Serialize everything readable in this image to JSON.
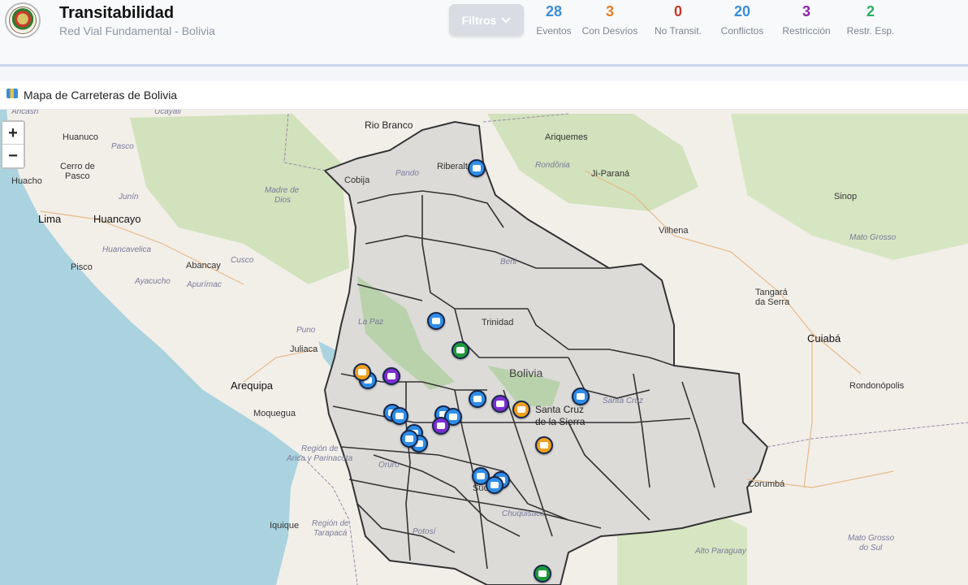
{
  "header": {
    "title": "Transitabilidad",
    "subtitle": "Red Vial Fundamental - Bolivia",
    "filter_label": "Filtros"
  },
  "stats": [
    {
      "value": "28",
      "label": "Eventos",
      "color": "#3b8ed6"
    },
    {
      "value": "3",
      "label": "Con Desvíos",
      "color": "#e67e22"
    },
    {
      "value": "0",
      "label": "No Transit.",
      "color": "#c0392b"
    },
    {
      "value": "20",
      "label": "Conflictos",
      "color": "#3b8ed6"
    },
    {
      "value": "3",
      "label": "Restricción",
      "color": "#8e24aa"
    },
    {
      "value": "2",
      "label": "Restr. Esp.",
      "color": "#27ae60"
    }
  ],
  "section": {
    "title": "Mapa de Carreteras de Bolivia"
  },
  "map": {
    "zoom_in": "+",
    "zoom_out": "−",
    "labels": {
      "rio_branco": "Rio Branco",
      "ariquemes": "Ariquemes",
      "huanuco": "Huanuco",
      "pasco": "Pasco",
      "cerro_de_pasco": "Cerro de",
      "cerro_de_pasco_2": "Pasco",
      "huacho": "Huacho",
      "lima": "Lima",
      "huancayo": "Huancayo",
      "pisco": "Pisco",
      "abancay": "Abancay",
      "cusco": "Cusco",
      "puno": "Puno",
      "juliaca": "Juliaca",
      "arequipa": "Arequipa",
      "moquegua": "Moquegua",
      "iquique": "Iquique",
      "cobija": "Cobija",
      "riberalta": "Riberalta",
      "ji_parana": "Ji-Paraná",
      "vilhena": "Vilhena",
      "sinop": "Sinop",
      "trinidad": "Trinidad",
      "bolivia": "Bolivia",
      "santa_cruz": "Santa Cruz",
      "de_la_sierra": "de la Sierra",
      "cuiaba": "Cuiabá",
      "tangara": "Tangará",
      "da_serra": "da Serra",
      "rondonopolis": "Rondonópolis",
      "corumba": "Corumbá",
      "sucre": "Sucre",
      "potosi": "Potosí",
      "oruro": "Oruro",
      "madre_de_dios": "Madre de",
      "madre_de_dios_2": "Dios",
      "junin": "Junín",
      "huancavelica": "Huancavelica",
      "ayacucho": "Ayacucho",
      "apurimac": "Apurímac",
      "rondonia": "Rondônia",
      "mato_grosso": "Mato Grosso",
      "mato_grosso_do_sul": "Mato Grosso",
      "do_sul": "do Sul",
      "alto_paraguay": "Alto Paraguay",
      "chuquisaca": "Chuquisaca",
      "region_arica": "Región de",
      "region_arica_2": "Arica y Parinacota",
      "region_tarapaca": "Región de",
      "region_tarapaca_2": "Tarapacá",
      "pando": "Pando",
      "beni": "Beni",
      "la_paz": "La Paz",
      "ancash": "Áncash",
      "ucayali": "Ucayali",
      "sta_cruz_region": "Santa Cruz"
    },
    "markers": [
      {
        "type": "conflict"
      },
      {
        "type": "conflict"
      },
      {
        "type": "conflict"
      },
      {
        "type": "conflict"
      },
      {
        "type": "conflict"
      },
      {
        "type": "conflict"
      },
      {
        "type": "conflict"
      },
      {
        "type": "conflict"
      },
      {
        "type": "conflict"
      },
      {
        "type": "conflict"
      },
      {
        "type": "conflict"
      },
      {
        "type": "conflict"
      },
      {
        "type": "conflict"
      },
      {
        "type": "conflict"
      },
      {
        "type": "conflict"
      },
      {
        "type": "detour"
      },
      {
        "type": "detour"
      },
      {
        "type": "detour"
      },
      {
        "type": "restriction"
      },
      {
        "type": "restriction"
      },
      {
        "type": "restriction"
      },
      {
        "type": "special"
      },
      {
        "type": "special"
      }
    ]
  }
}
